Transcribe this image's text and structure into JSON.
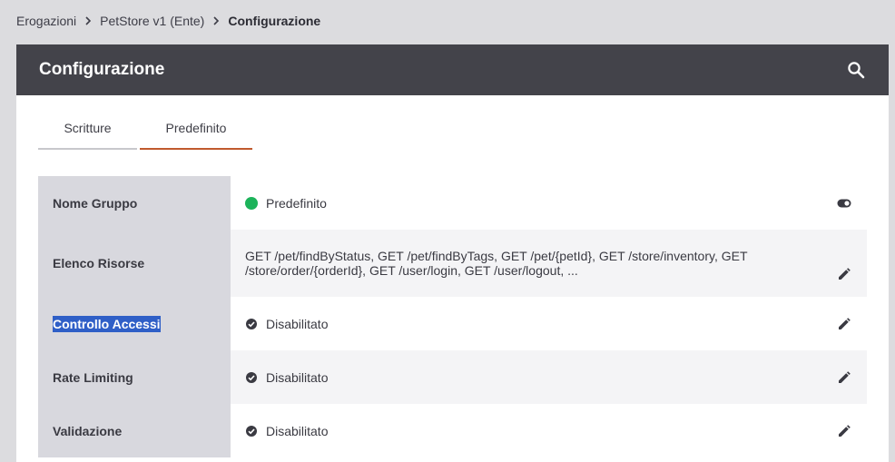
{
  "breadcrumb": {
    "items": [
      "Erogazioni",
      "PetStore v1 (Ente)"
    ],
    "current": "Configurazione"
  },
  "card": {
    "title": "Configurazione",
    "header_color": "#43434a"
  },
  "tabs": [
    {
      "label": "Scritture",
      "active": false
    },
    {
      "label": "Predefinito",
      "active": true
    }
  ],
  "rows": {
    "nome_gruppo": {
      "label": "Nome Gruppo",
      "value": "Predefinito",
      "status_color": "#1cb35a"
    },
    "elenco_risorse": {
      "label": "Elenco Risorse",
      "value": "GET /pet/findByStatus, GET /pet/findByTags, GET /pet/{petId}, GET /store/inventory, GET /store/order/{orderId}, GET /user/login, GET /user/logout, ..."
    },
    "controllo_accessi": {
      "label": "Controllo Accessi",
      "value": "Disabilitato"
    },
    "rate_limiting": {
      "label": "Rate Limiting",
      "value": "Disabilitato"
    },
    "validazione": {
      "label": "Validazione",
      "value": "Disabilitato"
    }
  },
  "colors": {
    "accent_tab": "#c05a2e",
    "selection": "#2f5fc7",
    "status_active": "#1cb35a"
  }
}
